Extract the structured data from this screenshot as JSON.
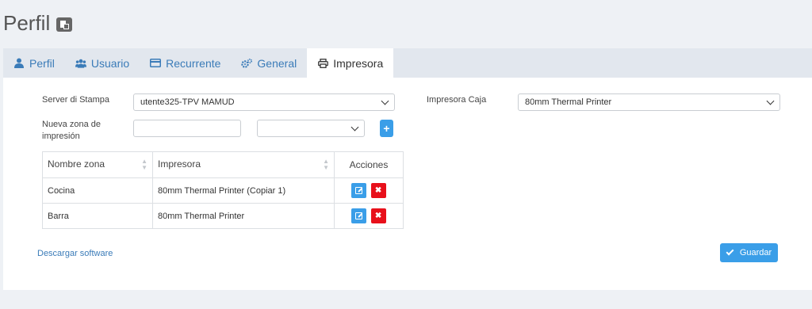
{
  "page": {
    "title": "Perfil"
  },
  "tabs": [
    {
      "label": "Perfil",
      "icon": "user-icon",
      "active": false
    },
    {
      "label": "Usuario",
      "icon": "users-icon",
      "active": false
    },
    {
      "label": "Recurrente",
      "icon": "credit-card-icon",
      "active": false
    },
    {
      "label": "General",
      "icon": "cogs-icon",
      "active": false
    },
    {
      "label": "Impresora",
      "icon": "print-icon",
      "active": true
    }
  ],
  "form": {
    "server_label": "Server di Stampa",
    "server_value": "utente325-TPV MAMUD",
    "cash_printer_label": "Impresora Caja",
    "cash_printer_value": "80mm Thermal Printer",
    "new_zone_label": "Nueva zona de impresión",
    "new_zone_value": "",
    "new_zone_printer_value": ""
  },
  "table": {
    "headers": [
      "Nombre zona",
      "Impresora",
      "Acciones"
    ],
    "rows": [
      {
        "zone": "Cocina",
        "printer": "80mm Thermal Printer (Copiar 1)"
      },
      {
        "zone": "Barra",
        "printer": "80mm Thermal Printer"
      }
    ]
  },
  "footer": {
    "download_link": "Descargar software",
    "save_label": "Guardar"
  },
  "colors": {
    "accent": "#3a9ee8",
    "danger": "#e8101b",
    "link": "#3a7bb8",
    "background": "#eef1f5"
  }
}
